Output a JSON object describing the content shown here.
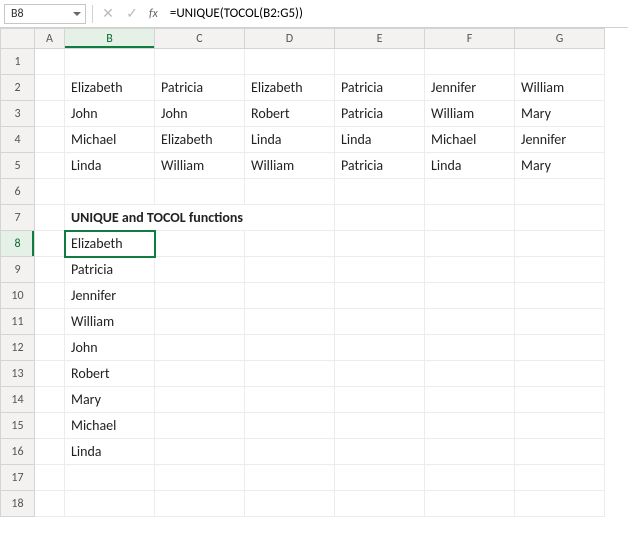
{
  "colors": {
    "accent_green": "#107c41",
    "spill_blue": "#2b579a",
    "header_bg": "#f3f2f1"
  },
  "name_box": {
    "value": "B8"
  },
  "formula_bar": {
    "cancel_icon": "✕",
    "accept_icon": "✓",
    "fx_label": "fx",
    "formula": "=UNIQUE(TOCOL(B2:G5))"
  },
  "columns": [
    "A",
    "B",
    "C",
    "D",
    "E",
    "F",
    "G"
  ],
  "rows": [
    "1",
    "2",
    "3",
    "4",
    "5",
    "6",
    "7",
    "8",
    "9",
    "10",
    "11",
    "12",
    "13",
    "14",
    "15",
    "16",
    "17",
    "18"
  ],
  "active_cell": "B8",
  "heading": "UNIQUE and TOCOL functions",
  "table_data": [
    [
      "Elizabeth",
      "Patricia",
      "Elizabeth",
      "Patricia",
      "Jennifer",
      "William"
    ],
    [
      "John",
      "John",
      "Robert",
      "Patricia",
      "William",
      "Mary"
    ],
    [
      "Michael",
      "Elizabeth",
      "Linda",
      "Linda",
      "Michael",
      "Jennifer"
    ],
    [
      "Linda",
      "William",
      "William",
      "Patricia",
      "Linda",
      "Mary"
    ]
  ],
  "unique_list": [
    "Elizabeth",
    "Patricia",
    "Jennifer",
    "William",
    "John",
    "Robert",
    "Mary",
    "Michael",
    "Linda"
  ]
}
